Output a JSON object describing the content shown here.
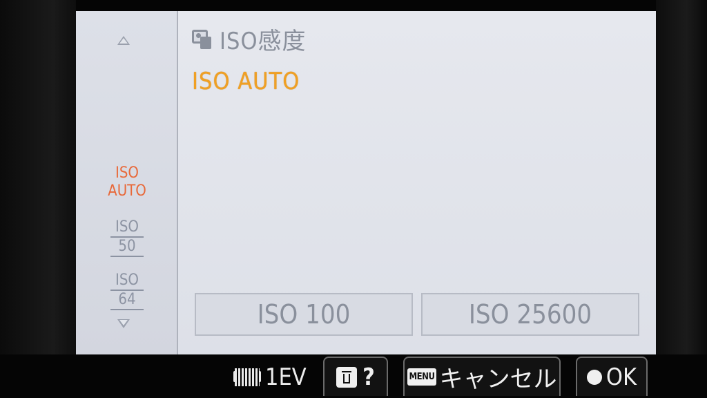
{
  "screen": {
    "title": "ISO感度",
    "current_value": "ISO AUTO",
    "accent_color": "#f0a024",
    "selected_color": "#e8693a"
  },
  "sidebar": {
    "items": [
      {
        "line1": "ISO",
        "line2": "AUTO",
        "selected": true
      },
      {
        "line1": "ISO",
        "line2": "50",
        "selected": false
      },
      {
        "line1": "ISO",
        "line2": "64",
        "selected": false
      }
    ]
  },
  "range": {
    "min_label": "ISO 100",
    "max_label": "ISO 25600"
  },
  "bottom": {
    "ev_label": "1EV",
    "help_label": "?",
    "menu_icon_label": "MENU",
    "cancel_label": "キャンセル",
    "ok_label": "OK"
  }
}
